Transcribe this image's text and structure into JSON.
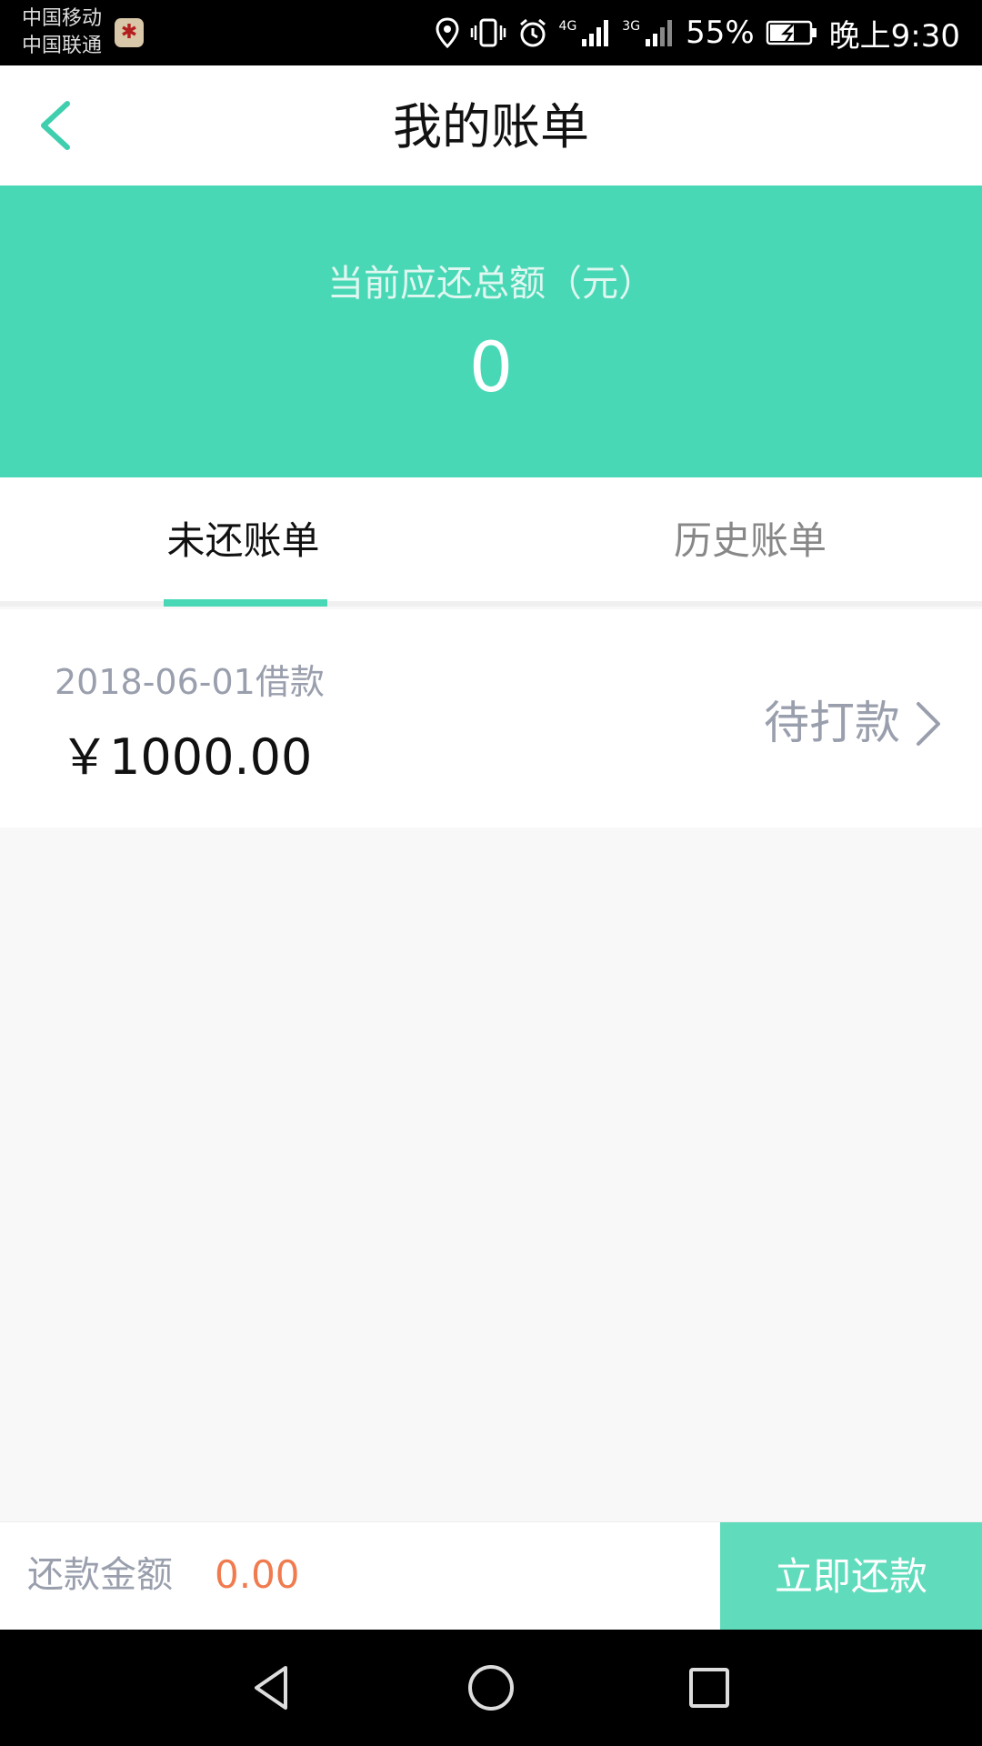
{
  "status_bar": {
    "carrier1": "中国移动",
    "carrier2": "中国联通",
    "net1": "4G",
    "net2": "3G",
    "battery": "55%",
    "time": "晚上9:30"
  },
  "nav": {
    "title": "我的账单"
  },
  "summary": {
    "label": "当前应还总额（元）",
    "value": "0"
  },
  "tabs": [
    {
      "label": "未还账单",
      "active": true
    },
    {
      "label": "历史账单",
      "active": false
    }
  ],
  "bills": [
    {
      "date": "2018-06-01借款",
      "amount": "￥1000.00",
      "status": "待打款"
    }
  ],
  "payment": {
    "label": "还款金额",
    "amount": "0.00",
    "button": "立即还款"
  },
  "colors": {
    "accent": "#48d8b6",
    "button": "#60dcbc",
    "amount_orange": "#f07b4e",
    "muted_text": "#9a9fad"
  }
}
